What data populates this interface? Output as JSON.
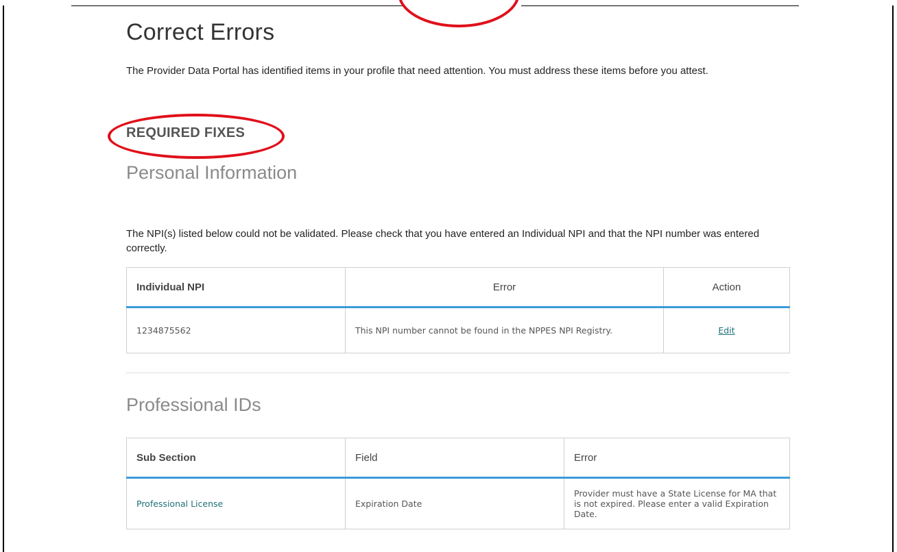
{
  "page": {
    "title": "Correct Errors",
    "intro": "The Provider Data Portal has identified items in your profile that need attention. You must address these items before you attest.",
    "required_heading": "REQUIRED FIXES"
  },
  "personal": {
    "heading": "Personal Information",
    "message": "The NPI(s) listed below could not be validated. Please check that you have entered an Individual NPI and that the NPI number was entered correctly.",
    "table": {
      "headers": [
        "Individual NPI",
        "Error",
        "Action"
      ],
      "rows": [
        {
          "npi": "1234875562",
          "error": "This NPI number cannot be found in the NPPES NPI Registry.",
          "action": "Edit"
        }
      ]
    }
  },
  "professional": {
    "heading": "Professional IDs",
    "table": {
      "headers": [
        "Sub Section",
        "Field",
        "Error"
      ],
      "rows": [
        {
          "sub_section": "Professional License",
          "field": "Expiration Date",
          "error": "Provider must have a State License for MA that is not expired. Please enter a valid Expiration Date."
        }
      ]
    }
  },
  "annotation_color": "#e0101a"
}
